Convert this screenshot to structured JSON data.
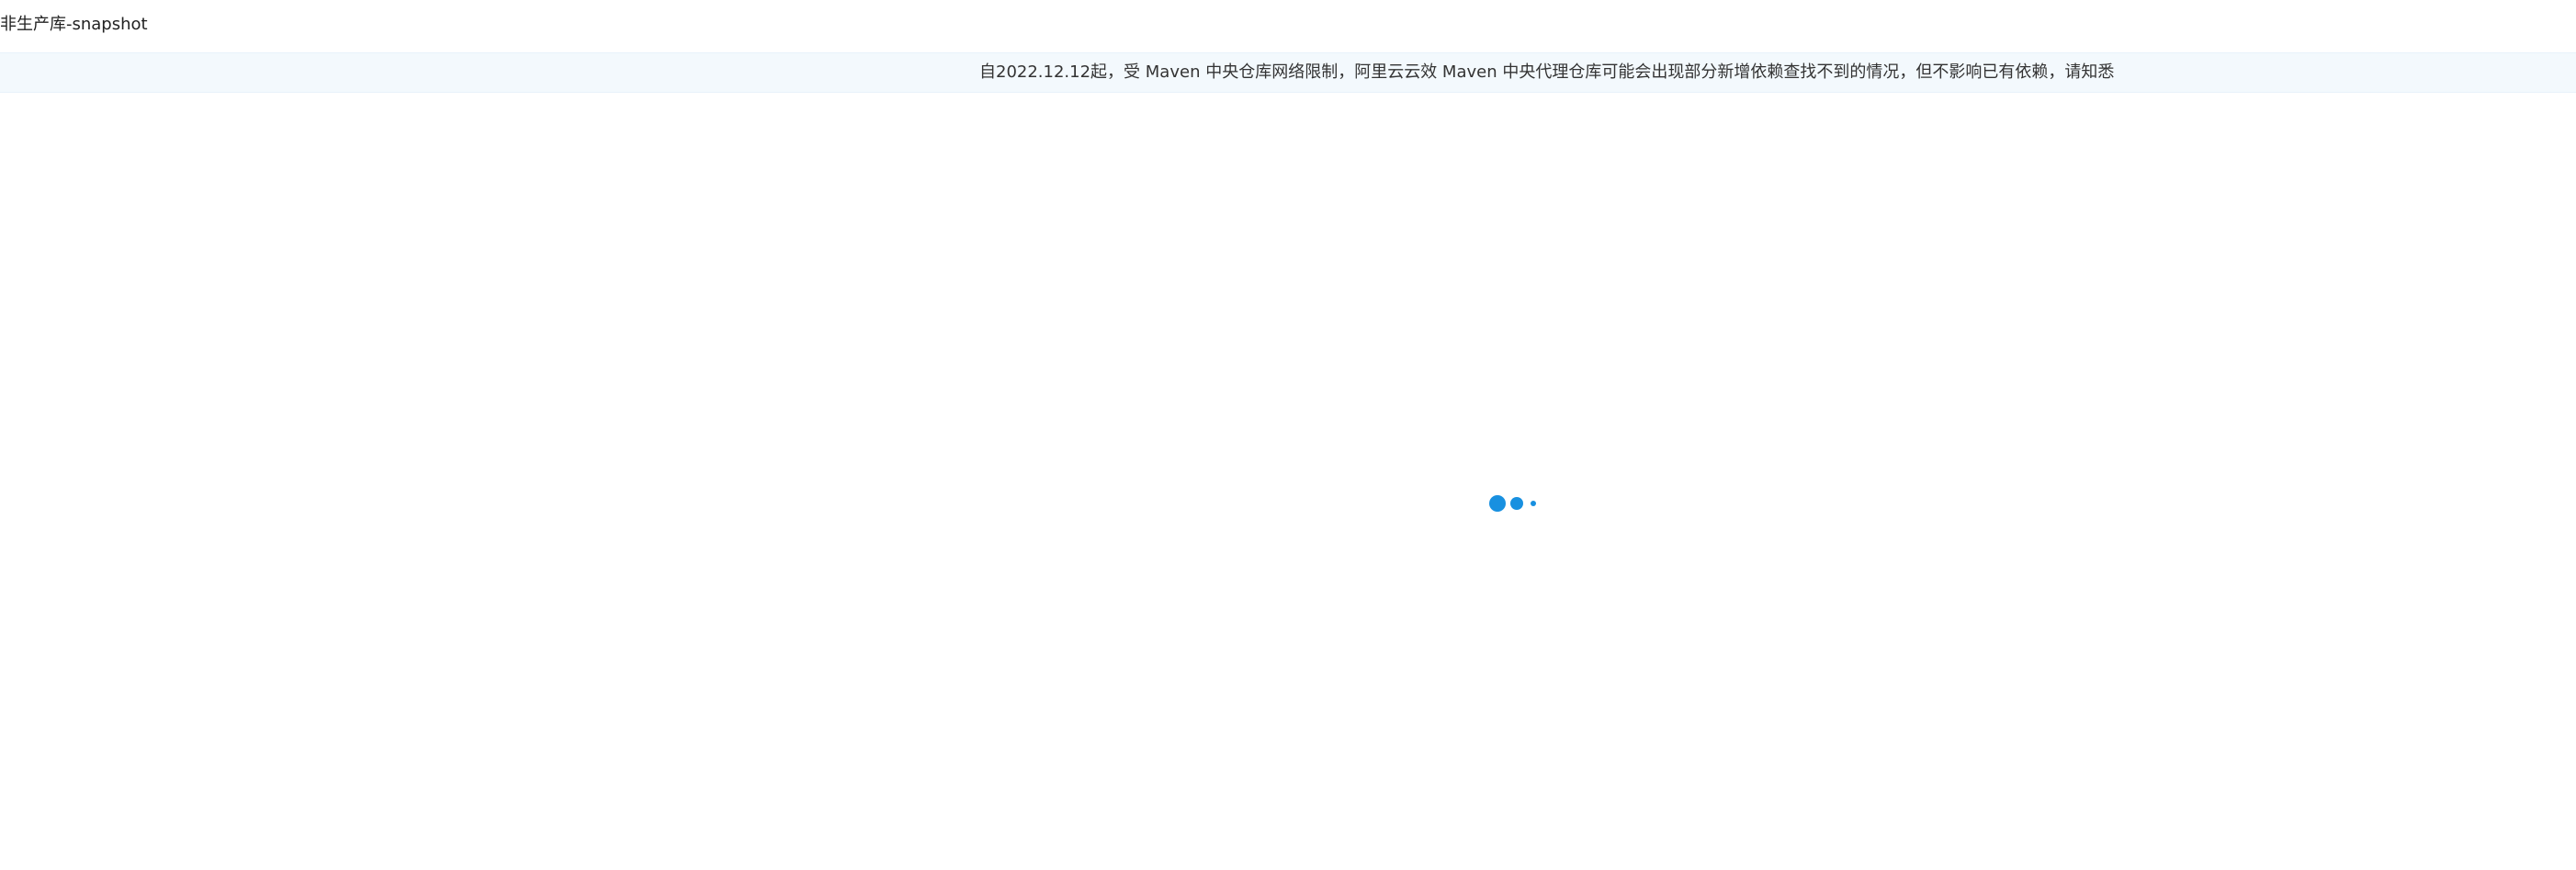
{
  "header": {
    "title": "非生产库-snapshot"
  },
  "notice": {
    "text": "自2022.12.12起，受 Maven 中央仓库网络限制，阿里云云效 Maven 中央代理仓库可能会出现部分新增依赖查找不到的情况，但不影响已有依赖，请知悉"
  },
  "loader": {
    "icon": "loading-dots-icon",
    "color": "#1890e0"
  },
  "colors": {
    "notice_background": "#f3f9fd",
    "accent": "#1890e0"
  }
}
